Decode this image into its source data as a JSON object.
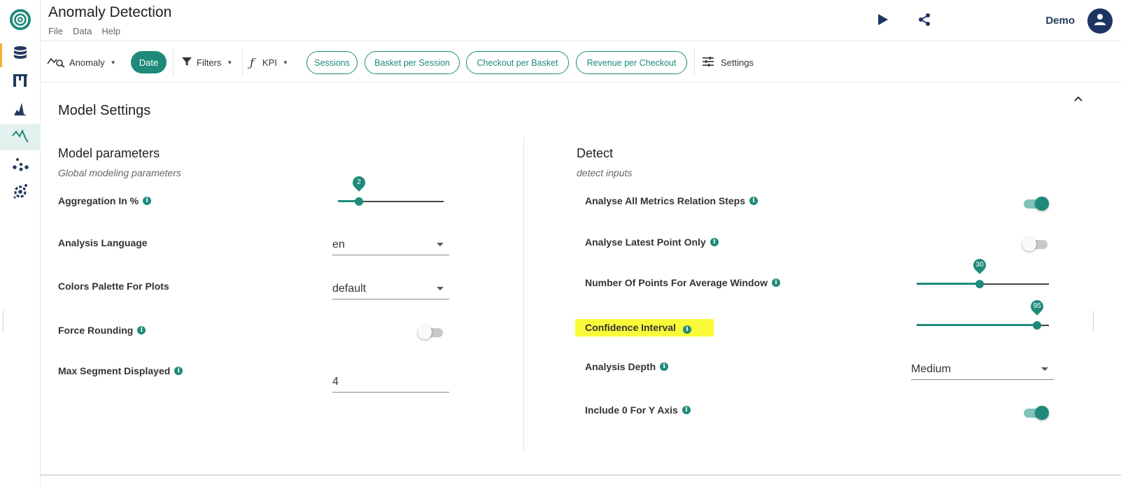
{
  "app": {
    "title": "Anomaly Detection",
    "menu": [
      "File",
      "Data",
      "Help"
    ],
    "user": "Demo"
  },
  "rail": {
    "items": [
      "database-icon",
      "layout-icon",
      "distribution-icon",
      "anomaly-icon",
      "scatter-icon",
      "settings-icon"
    ],
    "active": "anomaly-icon"
  },
  "toolbar": {
    "anomaly_label": "Anomaly",
    "date_label": "Date",
    "filters_label": "Filters",
    "kpi_label": "KPI",
    "chips": [
      "Sessions",
      "Basket per Session",
      "Checkout per Basket",
      "Revenue per Checkout"
    ],
    "settings_label": "Settings"
  },
  "panel": {
    "title": "Model Settings",
    "left": {
      "title": "Model parameters",
      "subtitle": "Global modeling parameters",
      "aggregation": {
        "label": "Aggregation In %",
        "value": "2",
        "fraction": 0.2
      },
      "language": {
        "label": "Analysis Language",
        "value": "en"
      },
      "palette": {
        "label": "Colors Palette For Plots",
        "value": "default"
      },
      "rounding": {
        "label": "Force Rounding",
        "on": false
      },
      "max_segment": {
        "label": "Max Segment Displayed",
        "value": "4"
      }
    },
    "right": {
      "title": "Detect",
      "subtitle": "detect inputs",
      "relation_steps": {
        "label": "Analyse All Metrics Relation Steps",
        "on": true
      },
      "latest_point": {
        "label": "Analyse Latest Point Only",
        "on": false
      },
      "avg_window": {
        "label": "Number Of Points For Average Window",
        "value": "30",
        "fraction": 0.475
      },
      "confidence": {
        "label": "Confidence Interval",
        "value": "95",
        "fraction": 0.91
      },
      "depth": {
        "label": "Analysis Depth",
        "value": "Medium"
      },
      "include_zero": {
        "label": "Include 0 For Y Axis",
        "on": true
      }
    }
  },
  "colors": {
    "accent": "#1f8a7a",
    "highlight": "#fafa3a",
    "avatar": "#1e3563",
    "rail_marker": "#f2b233"
  }
}
